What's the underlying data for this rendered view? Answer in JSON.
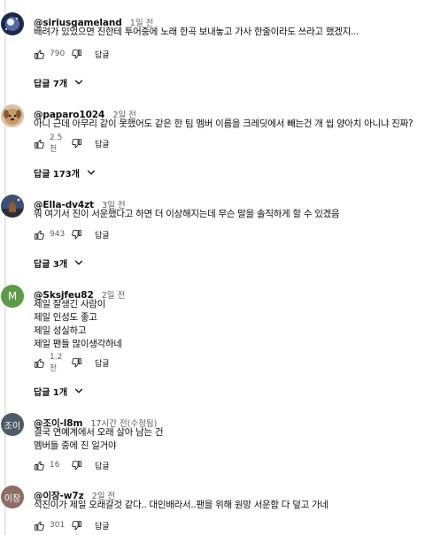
{
  "comments": [
    {
      "author": "@siriusgameland",
      "time": "1일 전",
      "lines": [
        "배려가 있었으면 진한테 투어중에 노래 한곡 보내놓고 가사 한줄이라도 쓰라고 했겠지..."
      ],
      "likes": "790",
      "reply_label": "답글",
      "replies_label": "답글 7개",
      "avatar_icon": "galaxy-avatar",
      "avatar_color": "#1b2a4a"
    },
    {
      "author": "@paparo1024",
      "time": "2일 전",
      "lines": [
        "아니 근데 아무리 같이 못했어도 같은 한 팀 멤버 이름을 크레딧에서 빼는건 개 씹 양아치 아니냐 진짜?"
      ],
      "likes": "2.5천",
      "reply_label": "답글",
      "replies_label": "답글 173개",
      "avatar_icon": "dog-avatar",
      "avatar_color": "#c89a6a"
    },
    {
      "author": "@Ella-dv4zt",
      "time": "3일 전",
      "lines": [
        "뭐 여기서 진이 서운했다고 하면 더 이상해지는데 무슨 말을 솔직하게 할 수 있겠음"
      ],
      "likes": "943",
      "reply_label": "답글",
      "replies_label": "답글 3개",
      "avatar_icon": "tower-avatar",
      "avatar_color": "#3a4f7a"
    },
    {
      "author": "@Sksjfeu82",
      "time": "2일 전",
      "lines": [
        "제일 잘생긴 사람이",
        "제일 인성도 좋고",
        "제일 성실하고",
        "제일 팬들 많이생각하네"
      ],
      "likes": "1.2천",
      "reply_label": "답글",
      "replies_label": "답글 1개",
      "avatar_letter": "M",
      "avatar_color": "#5d9b4a"
    },
    {
      "author": "@조이-l8m",
      "time": "17시간 전(수정됨)",
      "lines": [
        "결국 연예계에서 오래 살아 남는 건",
        "멤버들 중에 진 일거야"
      ],
      "likes": "16",
      "reply_label": "답글",
      "avatar_letter": "조이",
      "avatar_color": "#4f5b66"
    },
    {
      "author": "@이장-w7z",
      "time": "2일 전",
      "lines": [
        "석진이가 제일 오래갈것 같다.. 대인배라서..팬을 위해 원망 서운함 다 덮고 가네"
      ],
      "likes": "301",
      "reply_label": "답글",
      "avatar_letter": "이장",
      "avatar_color": "#8d6e63"
    }
  ]
}
